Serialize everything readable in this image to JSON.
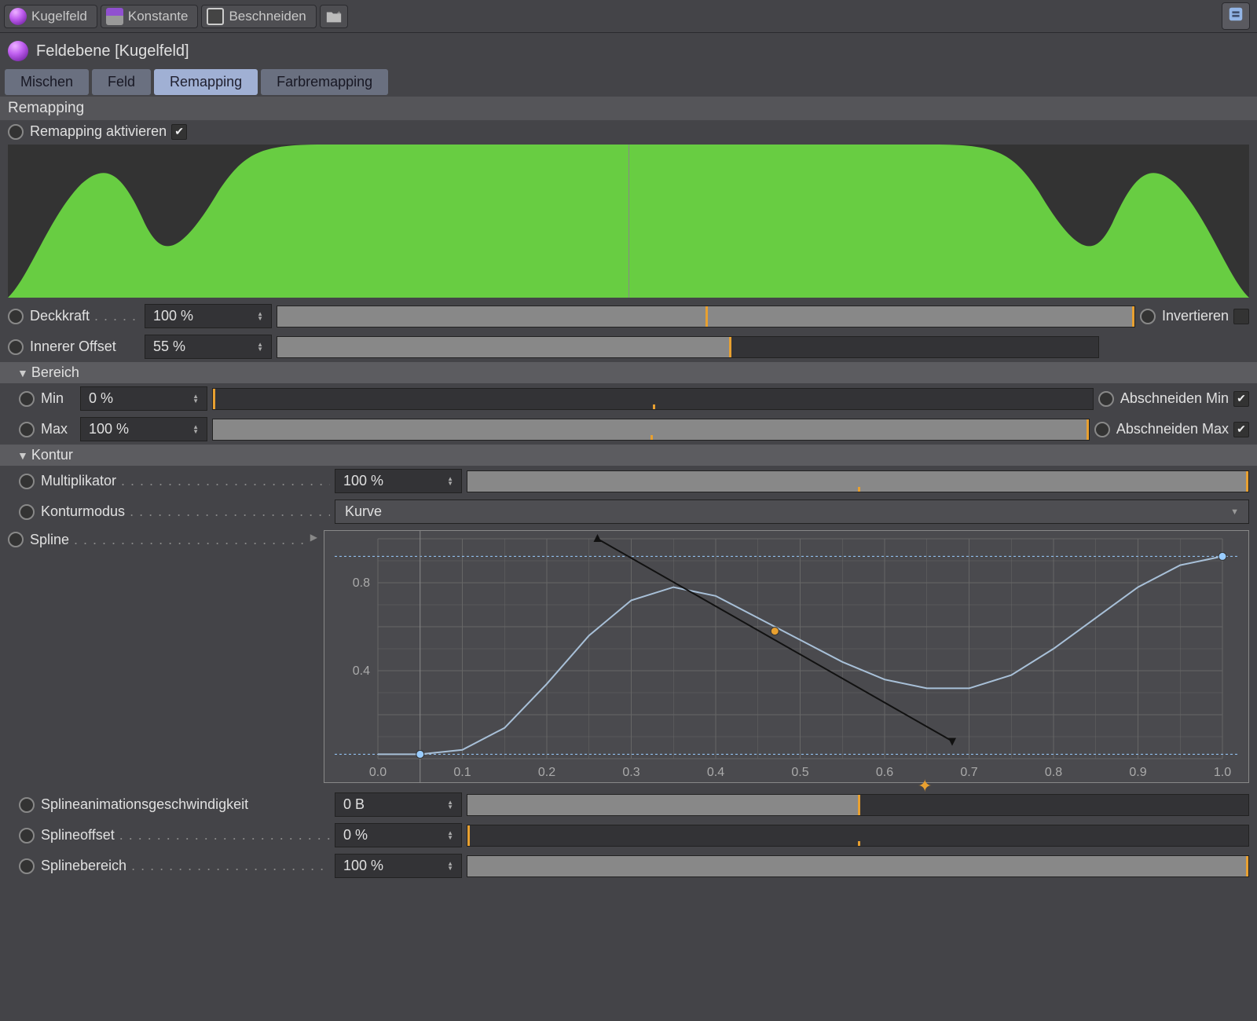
{
  "toolbar": {
    "kugelfeld": "Kugelfeld",
    "konstante": "Konstante",
    "beschneiden": "Beschneiden"
  },
  "object_name": "Feldebene [Kugelfeld]",
  "tabs": {
    "mischen": "Mischen",
    "feld": "Feld",
    "remapping": "Remapping",
    "farbremapping": "Farbremapping"
  },
  "section_remapping": "Remapping",
  "remap_enable": "Remapping aktivieren",
  "deckkraft_label": "Deckkraft",
  "deckkraft_value": "100 %",
  "invertieren": "Invertieren",
  "innerer_offset_label": "Innerer Offset",
  "innerer_offset_value": "55 %",
  "bereich": "Bereich",
  "min_label": "Min",
  "min_value": "0 %",
  "abschneiden_min": "Abschneiden Min",
  "max_label": "Max",
  "max_value": "100 %",
  "abschneiden_max": "Abschneiden Max",
  "kontur": "Kontur",
  "multiplikator_label": "Multiplikator",
  "multiplikator_value": "100 %",
  "konturmodus_label": "Konturmodus",
  "konturmodus_value": "Kurve",
  "spline_label": "Spline",
  "splineanimationsgeschwindigkeit_label": "Splineanimationsgeschwindigkeit",
  "splineanimationsgeschwindigkeit_value": "0 B",
  "splineoffset_label": "Splineoffset",
  "splineoffset_value": "0 %",
  "splinebereich_label": "Splinebereich",
  "splinebereich_value": "100 %",
  "chart_data": {
    "type": "line",
    "title": "",
    "xlabel": "",
    "ylabel": "",
    "xlim": [
      0.0,
      1.0
    ],
    "ylim": [
      0.0,
      1.0
    ],
    "x_ticks": [
      0.0,
      0.1,
      0.2,
      0.3,
      0.4,
      0.5,
      0.6,
      0.7,
      0.8,
      0.9,
      1.0
    ],
    "y_ticks": [
      0.4,
      0.8
    ],
    "knots": [
      {
        "x": 0.05,
        "y": 0.02
      },
      {
        "x": 0.47,
        "y": 0.58,
        "selected": true
      },
      {
        "x": 1.0,
        "y": 0.92
      }
    ],
    "curve_samples": [
      [
        0.0,
        0.02
      ],
      [
        0.05,
        0.02
      ],
      [
        0.1,
        0.04
      ],
      [
        0.15,
        0.14
      ],
      [
        0.2,
        0.34
      ],
      [
        0.25,
        0.56
      ],
      [
        0.3,
        0.72
      ],
      [
        0.35,
        0.78
      ],
      [
        0.4,
        0.74
      ],
      [
        0.45,
        0.64
      ],
      [
        0.5,
        0.54
      ],
      [
        0.55,
        0.44
      ],
      [
        0.6,
        0.36
      ],
      [
        0.65,
        0.32
      ],
      [
        0.7,
        0.32
      ],
      [
        0.75,
        0.38
      ],
      [
        0.8,
        0.5
      ],
      [
        0.85,
        0.64
      ],
      [
        0.9,
        0.78
      ],
      [
        0.95,
        0.88
      ],
      [
        1.0,
        0.92
      ]
    ],
    "tangent": {
      "from": [
        0.26,
        1.0
      ],
      "to": [
        0.68,
        0.08
      ]
    }
  }
}
